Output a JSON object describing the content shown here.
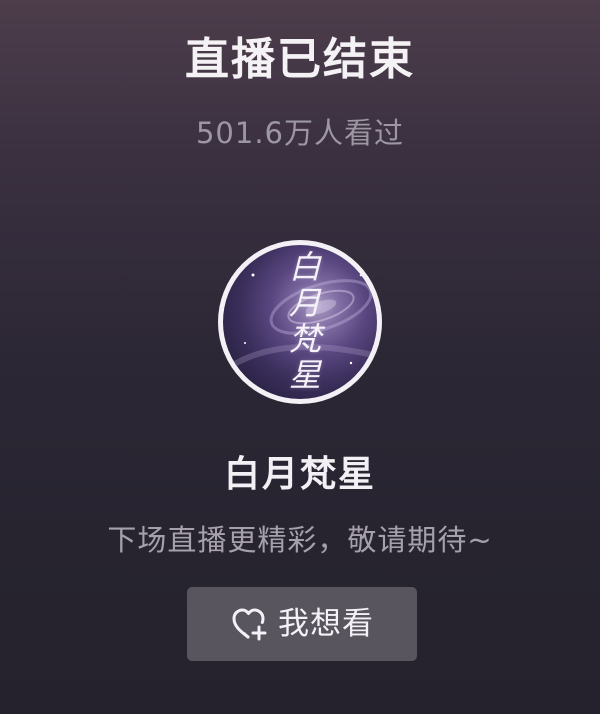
{
  "live": {
    "status_title": "直播已结束",
    "viewers_text": "501.6万人看过"
  },
  "streamer": {
    "avatar_text": "白月梵星",
    "name": "白月梵星",
    "message": "下场直播更精彩，敬请期待~"
  },
  "action": {
    "want_label": "我想看",
    "icon": "heart-plus-icon"
  },
  "colors": {
    "background_top": "#4d3d4b",
    "background_bottom": "#25222d",
    "button_bg": "#58555e",
    "text_primary": "#f4f2f5",
    "text_secondary": "#9d97a3"
  }
}
